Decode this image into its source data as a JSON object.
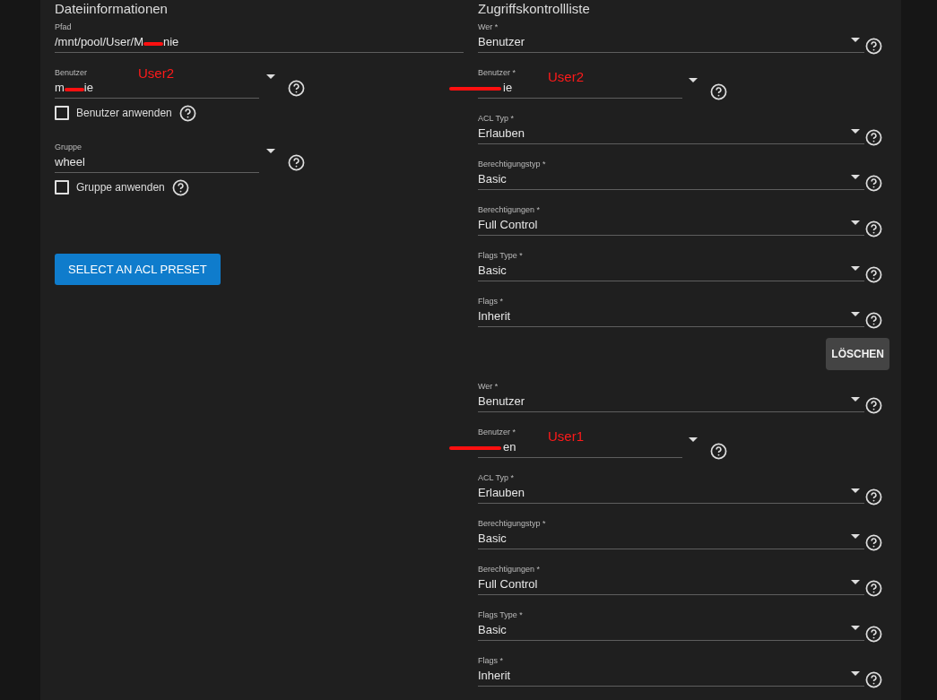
{
  "file_info": {
    "heading": "Dateiinformationen",
    "path": {
      "label": "Pfad",
      "value": "/mnt/pool/User/M",
      "redacted": true,
      "value_end": "nie"
    },
    "user": {
      "label": "Benutzer",
      "value": "m",
      "redacted": true,
      "value_end": "ie",
      "annotation": "User2"
    },
    "apply_user": {
      "label": "Benutzer anwenden",
      "checked": false
    },
    "group": {
      "label": "Gruppe",
      "value": "wheel"
    },
    "apply_group": {
      "label": "Gruppe anwenden",
      "checked": false
    },
    "preset_button": "SELECT AN ACL PRESET"
  },
  "acl": {
    "heading": "Zugriffskontrollliste",
    "entries": [
      {
        "fields": [
          {
            "kind": "select",
            "label": "Wer *",
            "value": "Benutzer"
          },
          {
            "kind": "user",
            "label": "Benutzer *",
            "redacted": true,
            "value_end": "ie",
            "annotation": "User2"
          },
          {
            "kind": "select",
            "label": "ACL Typ *",
            "value": "Erlauben"
          },
          {
            "kind": "select",
            "label": "Berechtigungstyp *",
            "value": "Basic"
          },
          {
            "kind": "select",
            "label": "Berechtigungen *",
            "value": "Full Control"
          },
          {
            "kind": "select",
            "label": "Flags Type *",
            "value": "Basic"
          },
          {
            "kind": "select",
            "label": "Flags *",
            "value": "Inherit"
          }
        ],
        "delete_button": "LÖSCHEN"
      },
      {
        "fields": [
          {
            "kind": "select",
            "label": "Wer *",
            "value": "Benutzer"
          },
          {
            "kind": "user",
            "label": "Benutzer *",
            "redacted": true,
            "value_end": "en",
            "annotation": "User1"
          },
          {
            "kind": "select",
            "label": "ACL Typ *",
            "value": "Erlauben"
          },
          {
            "kind": "select",
            "label": "Berechtigungstyp *",
            "value": "Basic"
          },
          {
            "kind": "select",
            "label": "Berechtigungen *",
            "value": "Full Control"
          },
          {
            "kind": "select",
            "label": "Flags Type *",
            "value": "Basic"
          },
          {
            "kind": "select",
            "label": "Flags *",
            "value": "Inherit"
          }
        ]
      }
    ]
  }
}
